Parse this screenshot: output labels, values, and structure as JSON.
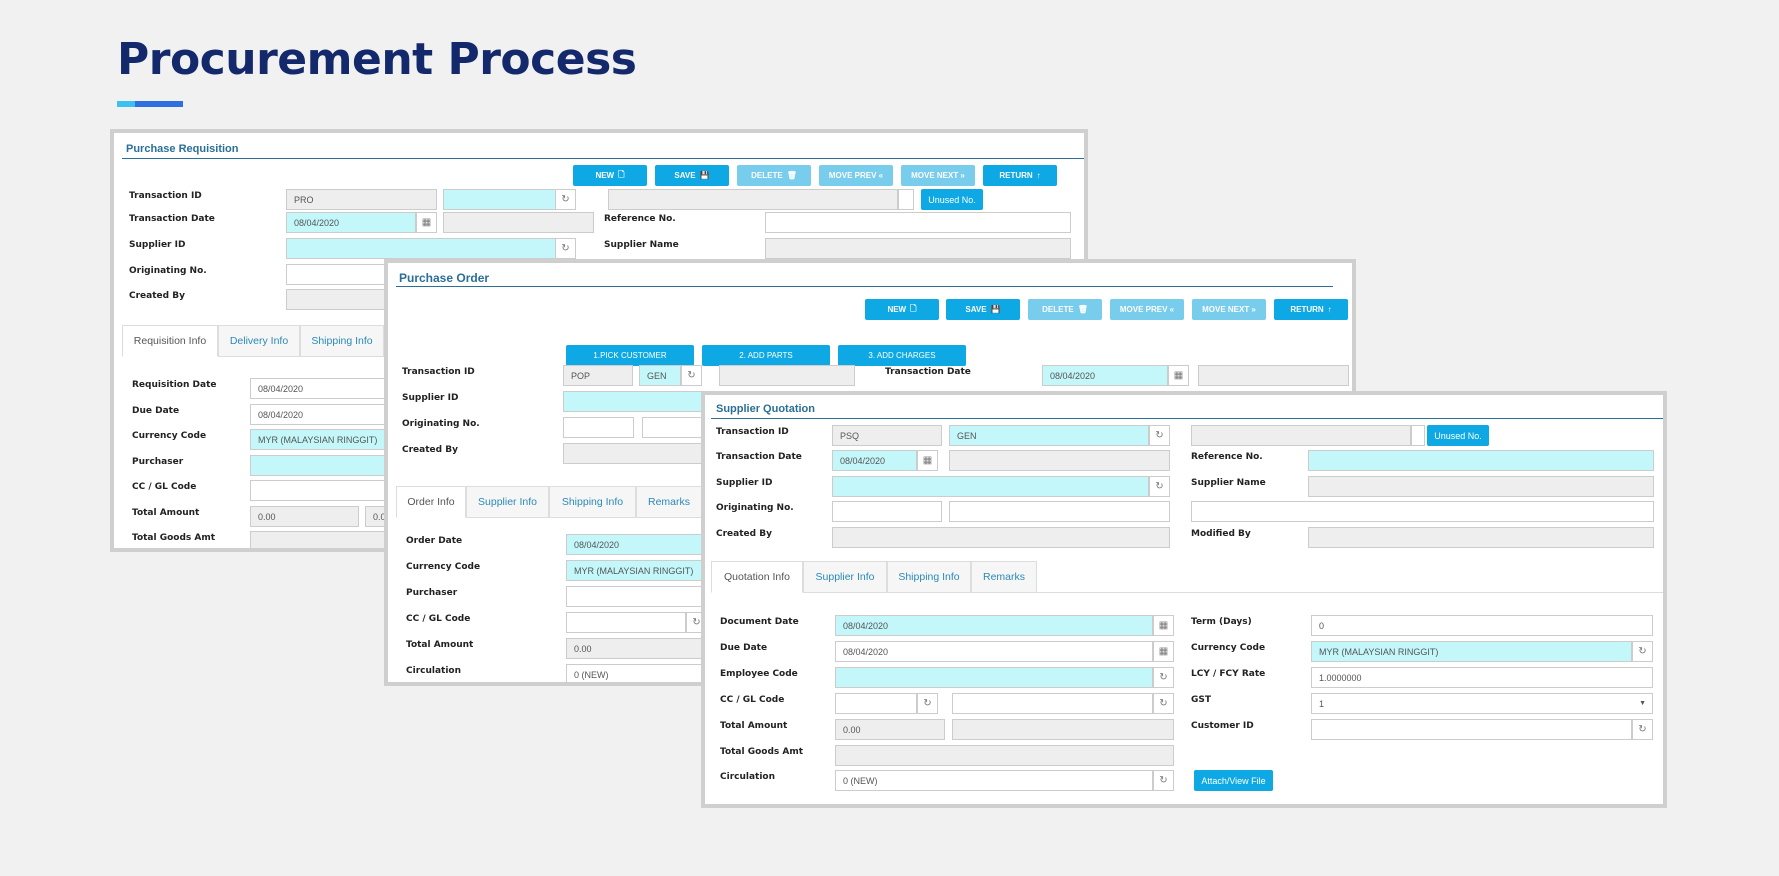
{
  "page": {
    "title": "Procurement Process"
  },
  "pr": {
    "title": "Purchase Requisition",
    "buttons": {
      "new": "NEW",
      "save": "SAVE",
      "delete": "DELETE",
      "prev": "MOVE PREV «",
      "next": "MOVE NEXT »",
      "return": "RETURN"
    },
    "labels": {
      "txn_id": "Transaction ID",
      "txn_date": "Transaction Date",
      "supplier_id": "Supplier ID",
      "orig_no": "Originating No.",
      "created_by": "Created By",
      "ref_no": "Reference No.",
      "supplier_name": "Supplier Name"
    },
    "values": {
      "txn_prefix": "PRO",
      "txn_date": "08/04/2020"
    },
    "unused_no": "Unused No.",
    "tabs": [
      "Requisition Info",
      "Delivery Info",
      "Shipping Info"
    ],
    "detail_labels": {
      "req_date": "Requisition Date",
      "due_date": "Due Date",
      "currency": "Currency Code",
      "purchaser": "Purchaser",
      "ccgl": "CC / GL Code",
      "total": "Total Amount",
      "goods": "Total Goods Amt"
    },
    "detail_values": {
      "req_date": "08/04/2020",
      "due_date": "08/04/2020",
      "currency": "MYR (MALAYSIAN RINGGIT)",
      "total": "0.00",
      "total2": "0.0"
    }
  },
  "po": {
    "title": "Purchase Order",
    "buttons": {
      "new": "NEW",
      "save": "SAVE",
      "delete": "DELETE",
      "prev": "MOVE PREV «",
      "next": "MOVE NEXT »",
      "return": "RETURN"
    },
    "steps": [
      "1.PICK CUSTOMER",
      "2. ADD PARTS",
      "3. ADD CHARGES"
    ],
    "labels": {
      "txn_id": "Transaction ID",
      "supplier_id": "Supplier ID",
      "orig_no": "Originating No.",
      "created_by": "Created By",
      "txn_date": "Transaction Date"
    },
    "values": {
      "txn_prefix": "POP",
      "txn_code": "GEN",
      "txn_date": "08/04/2020"
    },
    "tabs": [
      "Order Info",
      "Supplier Info",
      "Shipping Info",
      "Remarks"
    ],
    "detail_labels": {
      "order_date": "Order Date",
      "currency": "Currency Code",
      "purchaser": "Purchaser",
      "ccgl": "CC / GL Code",
      "total": "Total Amount",
      "circulation": "Circulation"
    },
    "detail_values": {
      "order_date": "08/04/2020",
      "currency": "MYR (MALAYSIAN RINGGIT)",
      "total": "0.00",
      "circulation": "0 (NEW)"
    }
  },
  "sq": {
    "title": "Supplier Quotation",
    "labels": {
      "txn_id": "Transaction ID",
      "txn_date": "Transaction Date",
      "supplier_id": "Supplier ID",
      "orig_no": "Originating No.",
      "created_by": "Created By",
      "ref_no": "Reference No.",
      "supplier_name": "Supplier Name",
      "modified_by": "Modified By"
    },
    "values": {
      "txn_prefix": "PSQ",
      "txn_code": "GEN",
      "txn_date": "08/04/2020"
    },
    "unused_no": "Unused No.",
    "tabs": [
      "Quotation Info",
      "Supplier Info",
      "Shipping Info",
      "Remarks"
    ],
    "detail_labels": {
      "doc_date": "Document Date",
      "due_date": "Due Date",
      "emp_code": "Employee Code",
      "ccgl": "CC / GL Code",
      "total": "Total Amount",
      "goods": "Total Goods Amt",
      "circulation": "Circulation",
      "term": "Term (Days)",
      "currency": "Currency Code",
      "rate": "LCY / FCY Rate",
      "gst": "GST",
      "customer_id": "Customer ID"
    },
    "detail_values": {
      "doc_date": "08/04/2020",
      "due_date": "08/04/2020",
      "total": "0.00",
      "circulation": "0 (NEW)",
      "term": "0",
      "currency": "MYR (MALAYSIAN RINGGIT)",
      "rate": "1.0000000",
      "gst": "1"
    },
    "attach": "Attach/View File"
  }
}
